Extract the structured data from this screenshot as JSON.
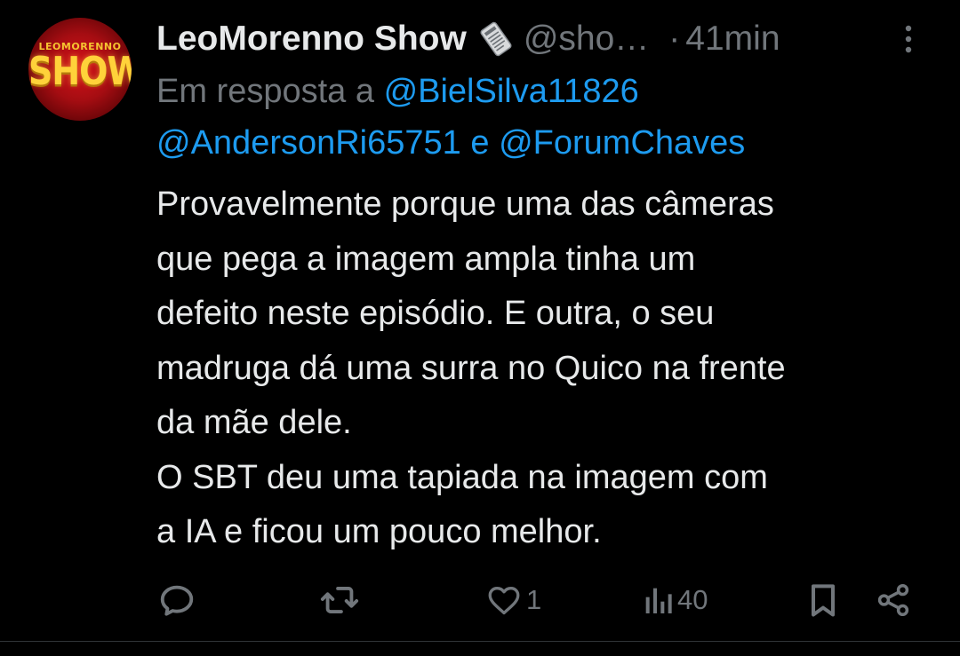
{
  "tweet": {
    "avatar": {
      "logo_top": "LEOMORENNO",
      "logo_main": "SHOW"
    },
    "author": {
      "display_name": "LeoMorenno Show",
      "badge_icon": "newspaper-icon",
      "handle": "@sho…"
    },
    "separator": "·",
    "time": "41min",
    "reply": {
      "prefix": "Em resposta a",
      "mention_1": "@BielSilva11826",
      "mention_2": "@AndersonRi65751",
      "joiner": "e",
      "mention_3": "@ForumChaves"
    },
    "text": "Provavelmente porque uma das câmeras\nque pega a imagem ampla tinha um\ndefeito neste episódio. E outra, o seu\nmadruga dá uma surra no Quico na frente\nda mãe dele.\nO SBT deu uma tapiada na imagem com\na IA e ficou um pouco melhor.",
    "actions": {
      "reply": {
        "icon": "reply-icon",
        "count": ""
      },
      "repost": {
        "icon": "repost-icon",
        "count": ""
      },
      "like": {
        "icon": "heart-icon",
        "count": "1"
      },
      "views": {
        "icon": "views-icon",
        "count": "40"
      },
      "bookmark": {
        "icon": "bookmark-icon"
      },
      "share": {
        "icon": "share-icon"
      }
    }
  },
  "colors": {
    "background": "#000000",
    "text": "#e7e9ea",
    "muted": "#71767b",
    "accent": "#1d9bf0",
    "divider": "#2f3336"
  }
}
